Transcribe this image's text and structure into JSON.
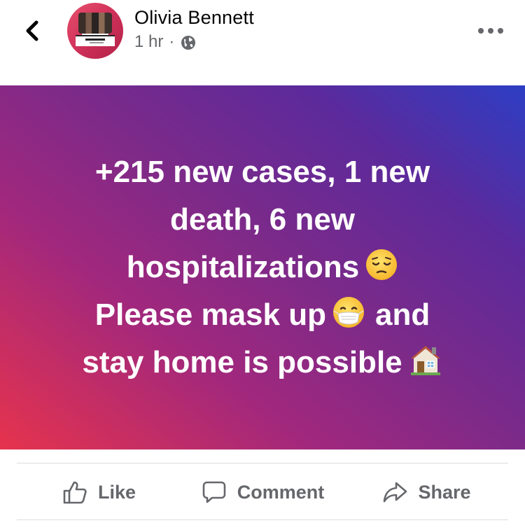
{
  "header": {
    "author_name": "Olivia Bennett",
    "time": "1 hr",
    "separator": "·",
    "privacy_icon": "globe-icon",
    "back_icon": "chevron-left-icon",
    "more_icon": "more-horizontal-icon"
  },
  "post": {
    "lines": [
      "+215 new cases, 1 new",
      "death, 6 new",
      "hospitalizations",
      "Please mask up",
      "and",
      "stay home is possible"
    ],
    "emojis": {
      "pensive": "pensive-face-emoji",
      "mask": "face-with-medical-mask-emoji",
      "house": "house-emoji"
    },
    "background_colors": [
      "#e6334d",
      "#a1287d",
      "#7a2a8a",
      "#5b2a9c",
      "#2d3ec4"
    ],
    "text_color": "#ffffff"
  },
  "actions": {
    "like_label": "Like",
    "comment_label": "Comment",
    "share_label": "Share",
    "like_icon": "thumbs-up-icon",
    "comment_icon": "comment-bubble-icon",
    "share_icon": "share-arrow-icon"
  }
}
